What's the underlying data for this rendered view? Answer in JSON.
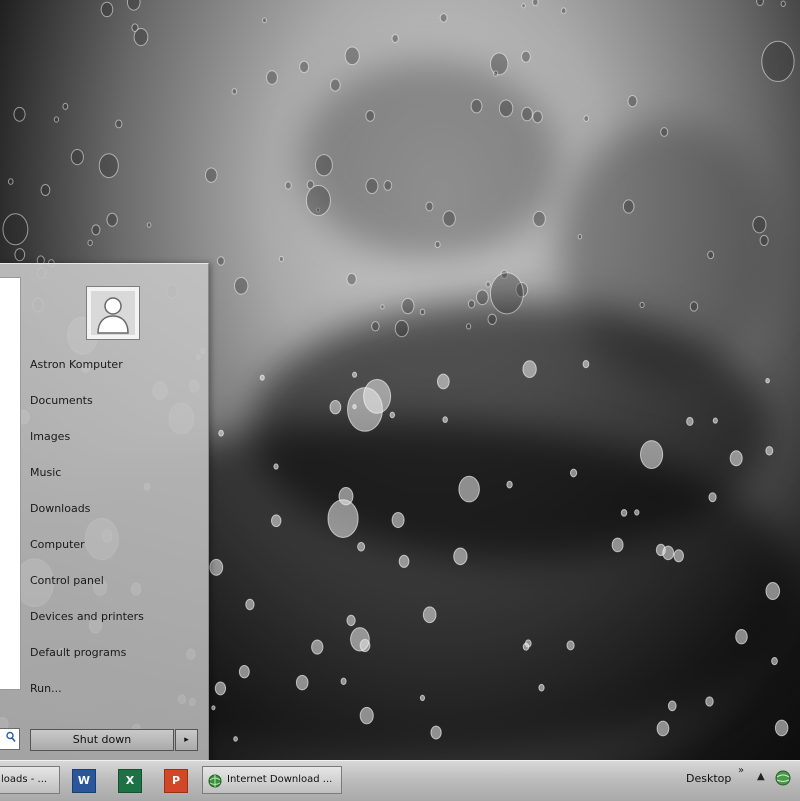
{
  "desktop": {
    "wallpaper": "rain-drops-on-glass"
  },
  "start_menu": {
    "user_icon": "user-avatar-icon",
    "links": [
      "Astron Komputer",
      "Documents",
      "Images",
      "Music",
      "Downloads",
      "Computer",
      "Control panel",
      "Devices and printers",
      "Default programs",
      "Run..."
    ],
    "shutdown_label": "Shut down",
    "shutdown_arrow": "▸",
    "search_icon": "search-icon"
  },
  "taskbar": {
    "tasks": [
      {
        "label": "loads - ...",
        "icon": "window-icon"
      },
      {
        "label": "Internet Download ...",
        "icon": "globe-icon"
      }
    ],
    "pinned": [
      {
        "name": "word-icon",
        "glyph": "W",
        "color": "#2b579a"
      },
      {
        "name": "excel-icon",
        "glyph": "X",
        "color": "#1e7145"
      },
      {
        "name": "powerpoint-icon",
        "glyph": "P",
        "color": "#d24726"
      }
    ],
    "desktop_label": "Desktop",
    "tray": {
      "chevron": "»",
      "up_arrow": "▲",
      "network_icon": "network-icon"
    }
  }
}
